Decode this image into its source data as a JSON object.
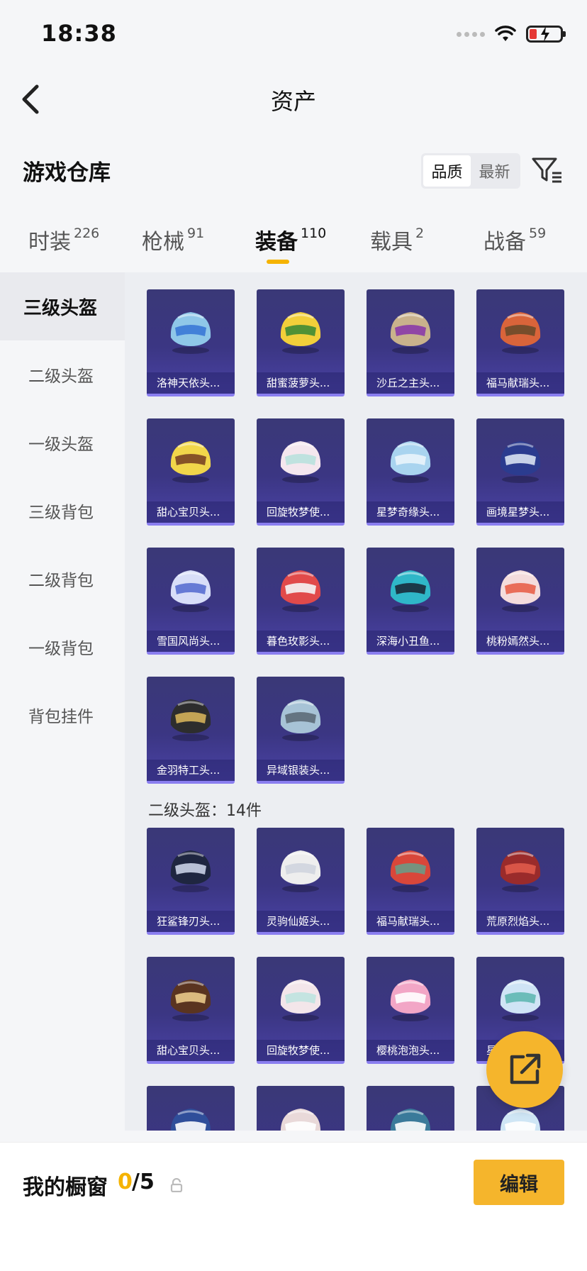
{
  "status_bar": {
    "time": "18:38"
  },
  "nav": {
    "title": "资产"
  },
  "header": {
    "warehouse_title": "游戏仓库",
    "sort_options": [
      "品质",
      "最新"
    ],
    "sort_selected": "品质"
  },
  "tabs": [
    {
      "label": "时装",
      "count": "226",
      "active": false
    },
    {
      "label": "枪械",
      "count": "91",
      "active": false
    },
    {
      "label": "装备",
      "count": "110",
      "active": true
    },
    {
      "label": "载具",
      "count": "2",
      "active": false
    },
    {
      "label": "战备",
      "count": "59",
      "active": false
    }
  ],
  "sidebar": {
    "items": [
      {
        "label": "三级头盔",
        "active": true
      },
      {
        "label": "二级头盔",
        "active": false
      },
      {
        "label": "一级头盔",
        "active": false
      },
      {
        "label": "三级背包",
        "active": false
      },
      {
        "label": "二级背包",
        "active": false
      },
      {
        "label": "一级背包",
        "active": false
      },
      {
        "label": "背包挂件",
        "active": false
      }
    ]
  },
  "sections": [
    {
      "title": "二级头盔：14件",
      "items": [
        {
          "name": "狂鲨锋刃头...",
          "icon": "shark-helmet-icon",
          "color": "#1f2640",
          "accent": "#c9d2e6"
        },
        {
          "name": "灵驹仙姬头...",
          "icon": "pony-helmet-icon",
          "color": "#eeeeee",
          "accent": "#cfd4de"
        },
        {
          "name": "福马献瑞头...",
          "icon": "horse-helmet-icon",
          "color": "#d9473a",
          "accent": "#6a9a86"
        },
        {
          "name": "荒原烈焰头...",
          "icon": "flame-helmet-icon",
          "color": "#9a2b2b",
          "accent": "#e05a4a"
        },
        {
          "name": "甜心宝贝头...",
          "icon": "sweetheart-helmet-icon",
          "color": "#5a3420",
          "accent": "#e9c98a"
        },
        {
          "name": "回旋牧梦使...",
          "icon": "sheep-helmet-icon",
          "color": "#f3e6ea",
          "accent": "#bfe3e0"
        },
        {
          "name": "樱桃泡泡头...",
          "icon": "cherry-helmet-icon",
          "color": "#f2a6c6",
          "accent": "#ffffff"
        },
        {
          "name": "星",
          "icon": "star-helmet-icon",
          "color": "#cfe4f5",
          "accent": "#5fb7b3"
        }
      ]
    }
  ],
  "top_section": {
    "items": [
      {
        "name": "洛神天依头...",
        "icon": "luoshen-helmet-icon",
        "color": "#8fc7e8",
        "accent": "#3a78d6"
      },
      {
        "name": "甜蜜菠萝头...",
        "icon": "pineapple-helmet-icon",
        "color": "#f2cf3a",
        "accent": "#3f8a35"
      },
      {
        "name": "沙丘之主头...",
        "icon": "dune-helmet-icon",
        "color": "#c9b28c",
        "accent": "#8a3aa8"
      },
      {
        "name": "福马献瑞头...",
        "icon": "horse-helmet-icon",
        "color": "#d9643a",
        "accent": "#6b4a2a"
      },
      {
        "name": "甜心宝贝头...",
        "icon": "sweetheart-helmet-icon",
        "color": "#f1d64a",
        "accent": "#7a4424"
      },
      {
        "name": "回旋牧梦使...",
        "icon": "sheep-helmet-icon",
        "color": "#f4e7ee",
        "accent": "#b9e1dd"
      },
      {
        "name": "星梦奇缘头...",
        "icon": "dream-helmet-icon",
        "color": "#a9d4ef",
        "accent": "#e9f4fb"
      },
      {
        "name": "画境星梦头...",
        "icon": "painting-helmet-icon",
        "color": "#2b3c8f",
        "accent": "#d8e2f2"
      },
      {
        "name": "雪国风尚头...",
        "icon": "snow-helmet-icon",
        "color": "#d8def8",
        "accent": "#5a6fd0"
      },
      {
        "name": "暮色玫影头...",
        "icon": "rose-helmet-icon",
        "color": "#e14a4a",
        "accent": "#f5f5f5"
      },
      {
        "name": "深海小丑鱼...",
        "icon": "clownfish-helmet-icon",
        "color": "#2fb7c8",
        "accent": "#1a2a3a"
      },
      {
        "name": "桃粉嫣然头...",
        "icon": "peach-helmet-icon",
        "color": "#f4dcdc",
        "accent": "#e8604a"
      },
      {
        "name": "金羽特工头...",
        "icon": "golden-agent-helmet-icon",
        "color": "#2d2d2d",
        "accent": "#d4b15a"
      },
      {
        "name": "异域银装头...",
        "icon": "silver-helmet-icon",
        "color": "#a7c3d6",
        "accent": "#5d6b78"
      }
    ]
  },
  "partial_row_colors": [
    "#2f4e9a",
    "#e9d9d9",
    "#3a7a9a",
    "#cfe6f5"
  ],
  "bottom_bar": {
    "showcase_label": "我的橱窗",
    "showcase_count": "0",
    "showcase_total": "/5",
    "edit_label": "编辑"
  },
  "theme": {
    "accent": "#f5b301",
    "card_bg": "#3b3683"
  }
}
